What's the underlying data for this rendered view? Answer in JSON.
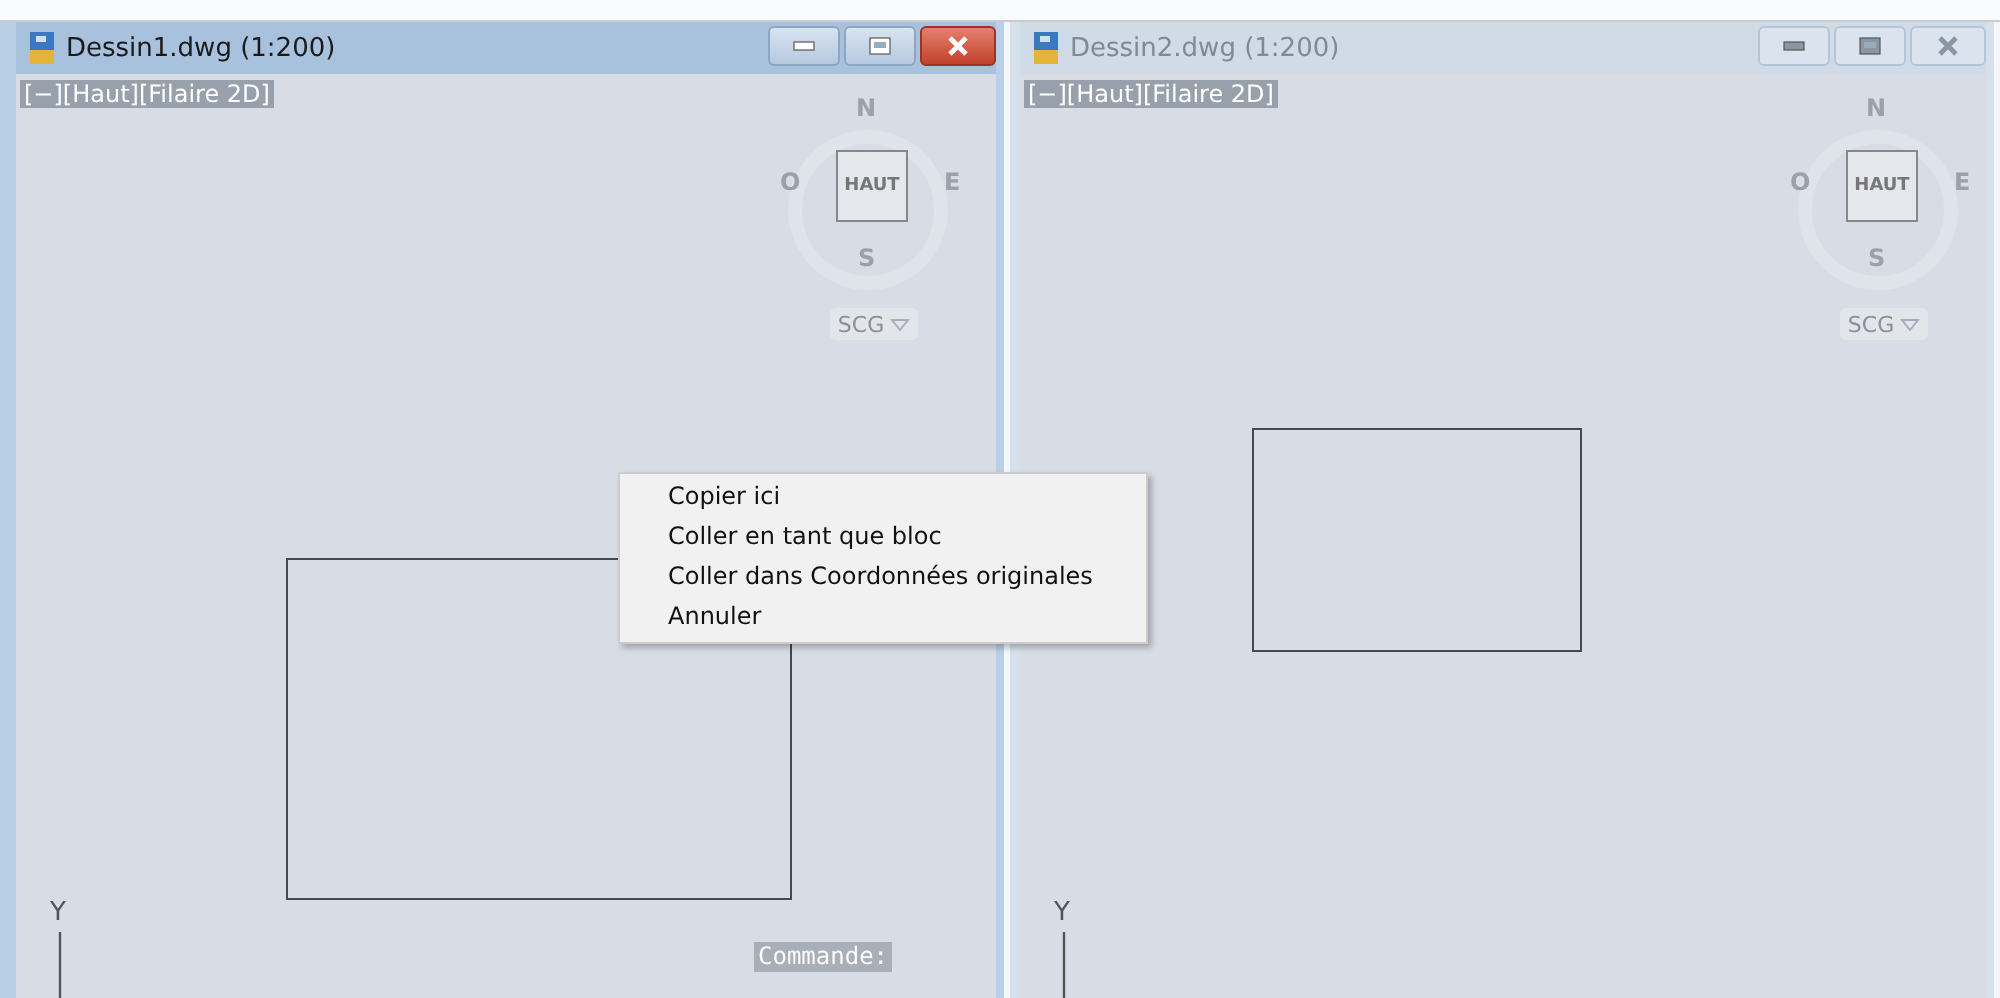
{
  "windows": [
    {
      "title": "Dessin1.dwg (1:200)",
      "active": true,
      "viewport_label": "[−][Haut][Filaire 2D]",
      "viewcube": {
        "face": "HAUT",
        "north": "N",
        "south": "S",
        "east": "E",
        "west": "O"
      },
      "ucs": "SCG",
      "axis_label": "Y",
      "command_lines": [
        "Commande:"
      ]
    },
    {
      "title": "Dessin2.dwg (1:200)",
      "active": false,
      "viewport_label": "[−][Haut][Filaire 2D]",
      "viewcube": {
        "face": "HAUT",
        "north": "N",
        "south": "S",
        "east": "E",
        "west": "O"
      },
      "ucs": "SCG",
      "axis_label": "Y"
    }
  ],
  "context_menu": {
    "items": [
      {
        "label": "Copier ici"
      },
      {
        "label": "Coller en tant que bloc"
      },
      {
        "label": "Coller dans Coordonnées originales"
      },
      {
        "label": "Annuler"
      }
    ]
  }
}
